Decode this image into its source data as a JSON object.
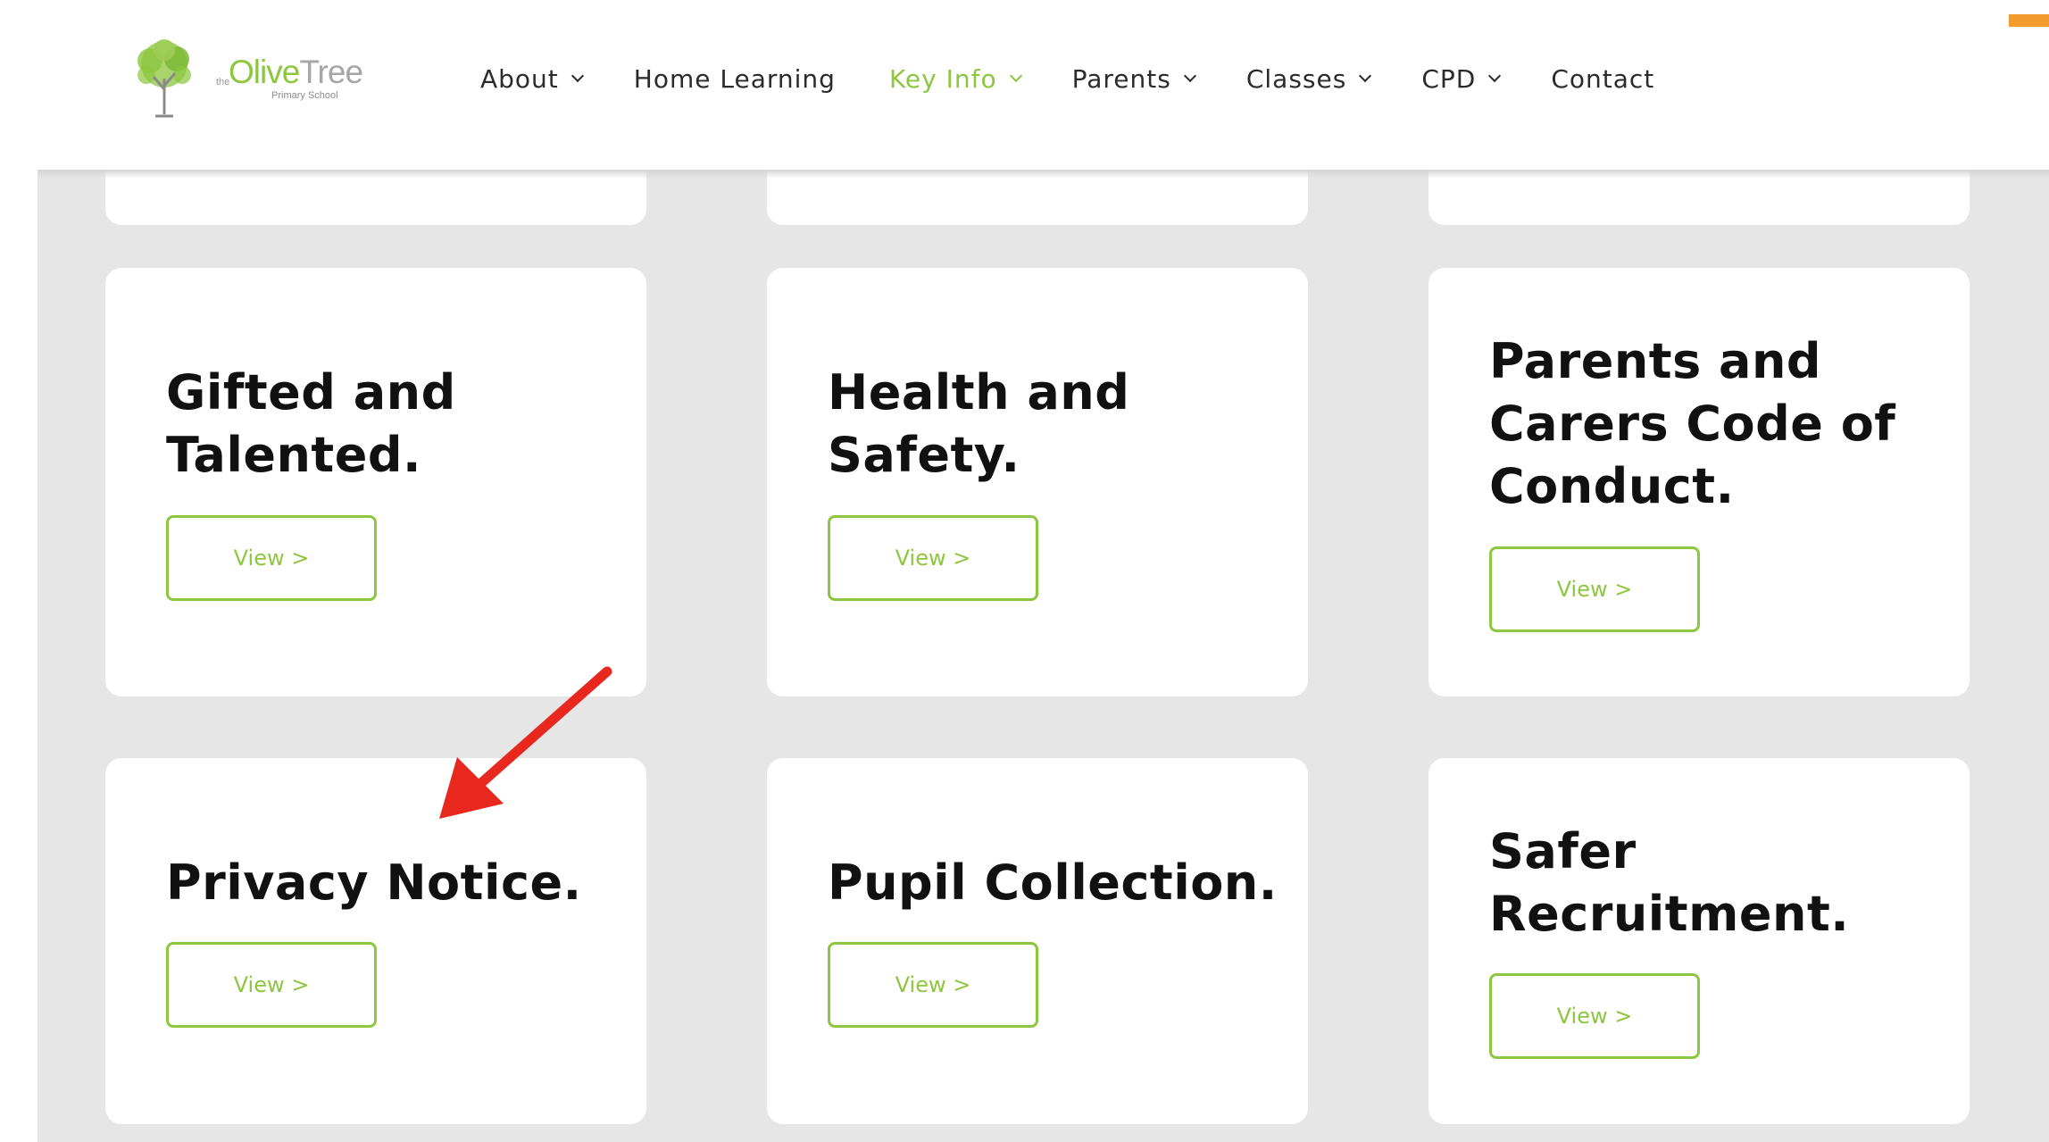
{
  "site": {
    "logo_prefix": "the",
    "logo_name_part1": "Olive",
    "logo_name_part2": "Tree",
    "logo_subtitle": "Primary School"
  },
  "nav": {
    "items": [
      {
        "label": "About",
        "has_dropdown": true
      },
      {
        "label": "Home Learning",
        "has_dropdown": false
      },
      {
        "label": "Key Info",
        "has_dropdown": true,
        "active": true
      },
      {
        "label": "Parents",
        "has_dropdown": true
      },
      {
        "label": "Classes",
        "has_dropdown": true
      },
      {
        "label": "CPD",
        "has_dropdown": true
      },
      {
        "label": "Contact",
        "has_dropdown": false
      }
    ]
  },
  "cards": [
    {
      "title": "Gifted and Talented.",
      "button": "View >"
    },
    {
      "title": "Health and Safety.",
      "button": "View >"
    },
    {
      "title": "Parents and Carers Code of Conduct.",
      "button": "View >"
    },
    {
      "title": "Privacy Notice.",
      "button": "View >"
    },
    {
      "title": "Pupil Collection.",
      "button": "View >"
    },
    {
      "title": "Safer Recruitment.",
      "button": "View >"
    }
  ],
  "colors": {
    "accent": "#8dc63f",
    "annotation_arrow": "#e8281e",
    "background": "#e6e6e6",
    "orange_tab": "#f39c2e"
  }
}
